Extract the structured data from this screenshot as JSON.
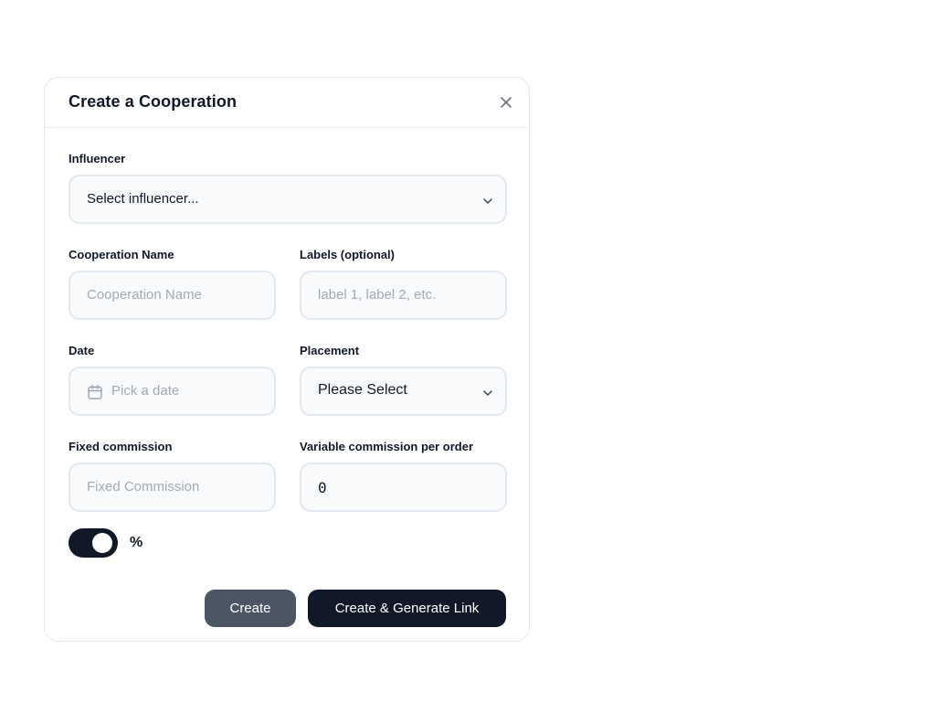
{
  "dialog": {
    "title": "Create a Cooperation",
    "close_icon": "close-icon"
  },
  "influencer": {
    "label": "Influencer",
    "value": "Select influencer...",
    "icon": "chevron-down-icon"
  },
  "cooperation_name": {
    "label": "Cooperation Name",
    "placeholder": "Cooperation Name"
  },
  "labels": {
    "label": "Labels (optional)",
    "placeholder": "label 1, label 2, etc."
  },
  "date": {
    "label": "Date",
    "placeholder": "Pick a date",
    "icon": "calendar-icon"
  },
  "placement": {
    "label": "Placement",
    "value": "Please Select",
    "icon": "chevron-down-icon"
  },
  "fixed_commission": {
    "label": "Fixed commission",
    "placeholder": "Fixed Commission"
  },
  "variable_commission": {
    "label": "Variable commission per order",
    "value": "0"
  },
  "percent_toggle": {
    "label": "%",
    "state": "on"
  },
  "actions": {
    "create_label": "Create",
    "create_generate_label": "Create & Generate Link"
  },
  "colors": {
    "primary": "#111827",
    "secondary_button": "#4b5563",
    "field_background": "#f8fafc",
    "border": "#e2e8f0"
  }
}
